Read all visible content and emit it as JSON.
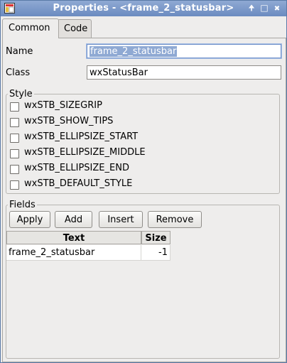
{
  "window": {
    "title": "Properties - <frame_2_statusbar>",
    "up_glyph": "🠉",
    "restore_glyph": "□",
    "close_glyph": "✖"
  },
  "tabs": [
    {
      "label": "Common",
      "active": true
    },
    {
      "label": "Code",
      "active": false
    }
  ],
  "common": {
    "name_label": "Name",
    "name_value": "frame_2_statusbar",
    "class_label": "Class",
    "class_value": "wxStatusBar"
  },
  "style": {
    "legend": "Style",
    "options": [
      {
        "label": "wxSTB_SIZEGRIP",
        "checked": false
      },
      {
        "label": "wxSTB_SHOW_TIPS",
        "checked": false
      },
      {
        "label": "wxSTB_ELLIPSIZE_START",
        "checked": false
      },
      {
        "label": "wxSTB_ELLIPSIZE_MIDDLE",
        "checked": false
      },
      {
        "label": "wxSTB_ELLIPSIZE_END",
        "checked": false
      },
      {
        "label": "wxSTB_DEFAULT_STYLE",
        "checked": false
      }
    ]
  },
  "fields": {
    "legend": "Fields",
    "buttons": {
      "apply": "Apply",
      "add": "Add",
      "insert": "Insert",
      "remove": "Remove"
    },
    "columns": [
      "Text",
      "Size"
    ],
    "rows": [
      {
        "text": "frame_2_statusbar",
        "size": "-1"
      }
    ]
  },
  "colors": {
    "titlebar": "#7a97c9",
    "selection": "#8fa9d3"
  }
}
